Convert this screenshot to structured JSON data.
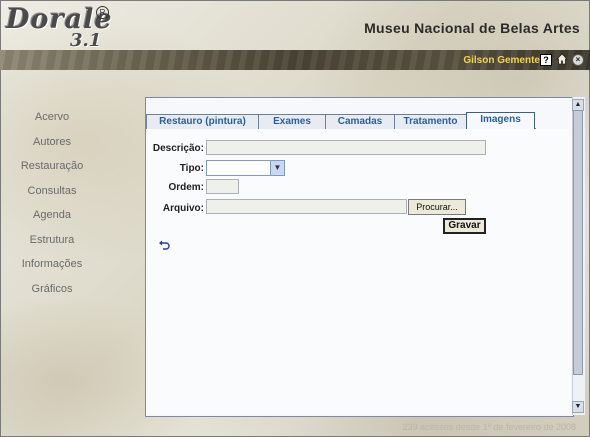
{
  "header": {
    "logo_main": "Dorale",
    "logo_reg": "R",
    "logo_version": "3.1",
    "museum_title": "Museu Nacional de Belas Artes",
    "user_name": "Gilson Gemente",
    "help_symbol": "?",
    "close_symbol": "×"
  },
  "sidebar": {
    "items": [
      {
        "label": "Acervo"
      },
      {
        "label": "Autores"
      },
      {
        "label": "Restauração"
      },
      {
        "label": "Consultas"
      },
      {
        "label": "Agenda"
      },
      {
        "label": "Estrutura"
      },
      {
        "label": "Informações"
      },
      {
        "label": "Gráficos"
      }
    ]
  },
  "tabs": [
    {
      "label": "Restauro (pintura)"
    },
    {
      "label": "Exames"
    },
    {
      "label": "Camadas"
    },
    {
      "label": "Tratamento"
    },
    {
      "label": "Imagens",
      "active": true
    }
  ],
  "form": {
    "descricao_label": "Descrição:",
    "descricao_value": "",
    "tipo_label": "Tipo:",
    "tipo_value": "",
    "ordem_label": "Ordem:",
    "ordem_value": "",
    "arquivo_label": "Arquivo:",
    "arquivo_value": "",
    "browse_label": "Procurar...",
    "save_label": "Gravar"
  },
  "scrollbar": {
    "up_symbol": "▲",
    "down_symbol": "▼"
  },
  "footer": {
    "text": "239 acessos desde 1º de fevereiro de 2008"
  },
  "icons": {
    "help": "help-icon",
    "home": "home-icon",
    "close": "close-icon",
    "undo": "undo-icon"
  },
  "colors": {
    "tab_text": "#2a5f98",
    "user_name": "#f2d54a"
  }
}
